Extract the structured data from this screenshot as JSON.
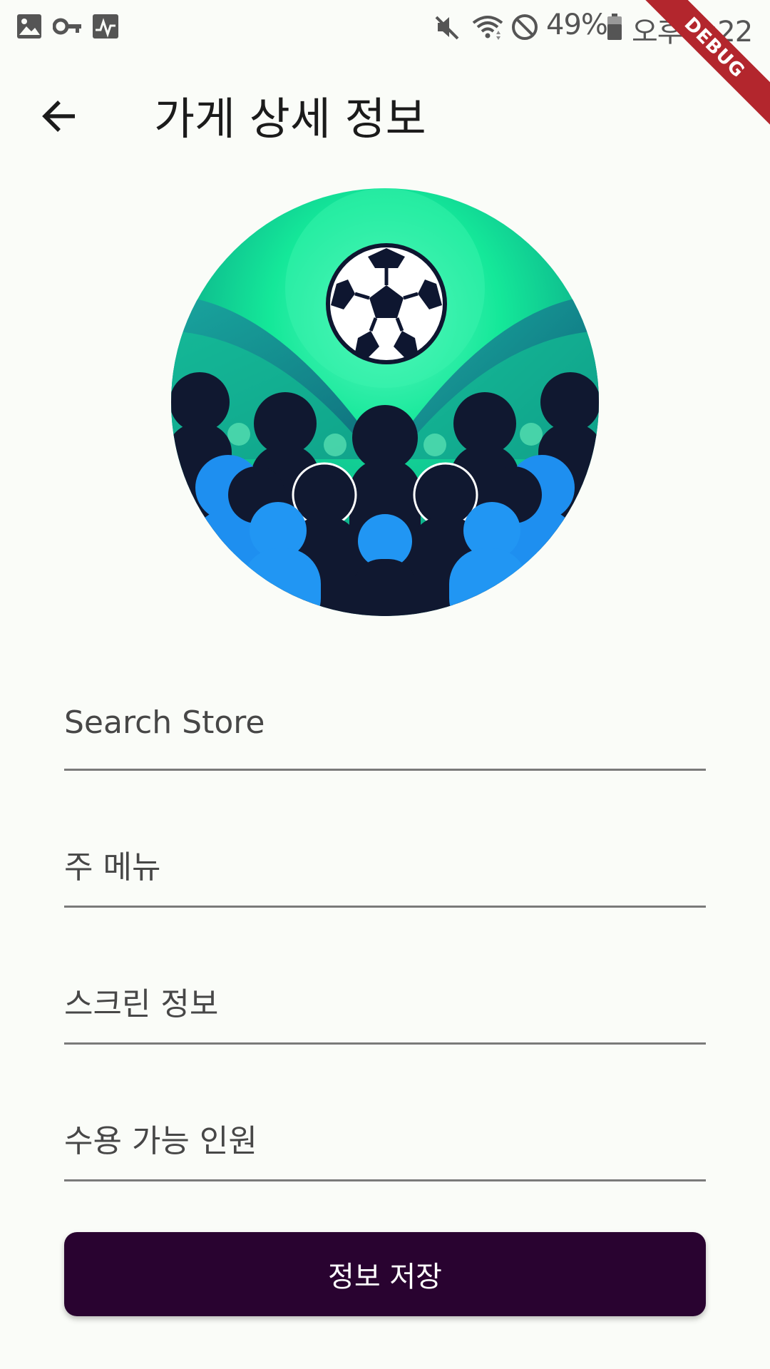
{
  "status_bar": {
    "left_icons": [
      "gallery-icon",
      "key-icon",
      "activity-icon"
    ],
    "right_icons": [
      "mute-icon",
      "wifi-icon",
      "block-icon",
      "battery-icon"
    ],
    "battery": "49%",
    "time": "오후 9:22"
  },
  "debug_banner": "DEBUG",
  "app_bar": {
    "back_icon": "arrow-back-icon",
    "title": "가게 상세 정보"
  },
  "store_image": {
    "colors": {
      "accent": "#14e899",
      "crowd_dark": "#101830",
      "crowd_blue": "#1e8ff0"
    }
  },
  "form": {
    "fields": [
      {
        "label": "Search Store",
        "value": ""
      },
      {
        "label": "주 메뉴",
        "value": ""
      },
      {
        "label": "스크린 정보",
        "value": ""
      },
      {
        "label": "수용 가능 인원",
        "value": ""
      }
    ],
    "save_label": "정보 저장"
  },
  "colors": {
    "background": "#fafcf8",
    "primary_button": "#290330",
    "underline": "#7a7a7a",
    "debug_ribbon": "#b3262d"
  }
}
